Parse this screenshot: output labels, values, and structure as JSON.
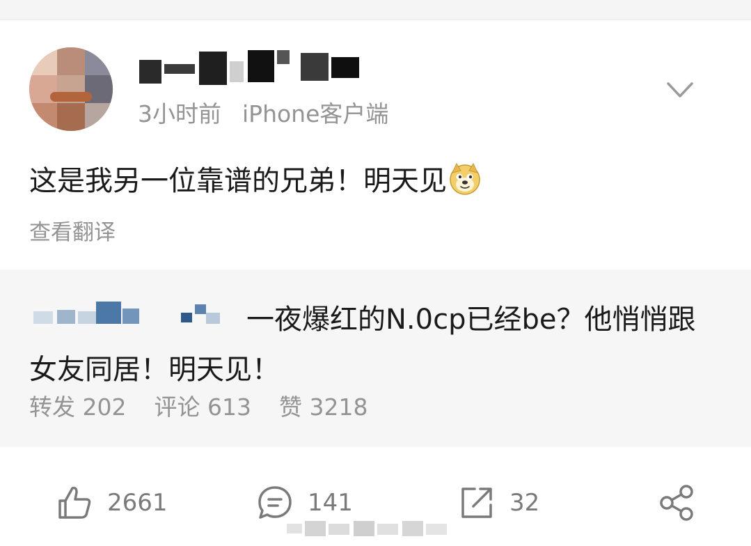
{
  "header": {
    "timestamp": "3小时前",
    "client": "iPhone客户端",
    "menu_icon": "chevron-down-icon"
  },
  "post": {
    "text": "这是我另一位靠谱的兄弟！明天见",
    "emoji": "doge-emoji",
    "translate_label": "查看翻译"
  },
  "repost": {
    "text": "一夜爆红的N.0cp已经be？他悄悄跟女友同居！明天见！",
    "stats": {
      "forward_label": "转发",
      "forward_count": "202",
      "comment_label": "评论",
      "comment_count": "613",
      "like_label": "赞",
      "like_count": "3218"
    }
  },
  "actions": {
    "like": {
      "icon": "thumbs-up-icon",
      "count": "2661"
    },
    "comment": {
      "icon": "comment-bubble-icon",
      "count": "141"
    },
    "repost": {
      "icon": "share-out-icon",
      "count": "32"
    },
    "share": {
      "icon": "share-nodes-icon"
    }
  },
  "colors": {
    "text_primary": "#1a1a1a",
    "text_secondary": "#939393",
    "icon": "#7a7a7a",
    "repost_bg": "#f6f6f6"
  }
}
